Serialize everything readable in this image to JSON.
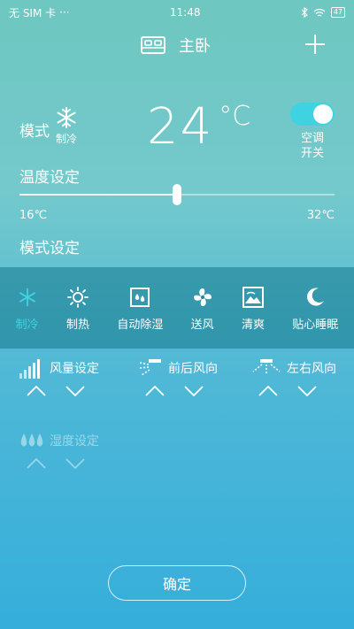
{
  "status": {
    "carrier": "无 SIM 卡",
    "time": "11:48",
    "battery": "47"
  },
  "header": {
    "room": "主卧"
  },
  "mode": {
    "label": "模式",
    "current": "制冷"
  },
  "temperature": {
    "value": "24",
    "unit": "°C"
  },
  "power": {
    "label_line1": "空调",
    "label_line2": "开关",
    "on": true
  },
  "temp_setting": {
    "label": "温度设定",
    "min_label": "16℃",
    "max_label": "32℃",
    "min": 16,
    "max": 32,
    "value": 24
  },
  "mode_setting": {
    "label": "模式设定"
  },
  "modes": [
    {
      "label": "制冷",
      "icon": "snowflake-icon",
      "active": true
    },
    {
      "label": "制热",
      "icon": "sun-icon",
      "active": false
    },
    {
      "label": "自动除湿",
      "icon": "droplet-icon",
      "active": false
    },
    {
      "label": "送风",
      "icon": "fan-icon",
      "active": false
    },
    {
      "label": "清爽",
      "icon": "landscape-icon",
      "active": false
    },
    {
      "label": "贴心睡眠",
      "icon": "moon-icon",
      "active": false
    }
  ],
  "controls": {
    "fan_speed": "风量设定",
    "vertical_swing": "前后风向",
    "horizontal_swing": "左右风向",
    "humidity": "湿度设定"
  },
  "confirm": {
    "label": "确定"
  },
  "colors": {
    "accent": "#3fd3e2",
    "band": "#1a8ba0"
  }
}
